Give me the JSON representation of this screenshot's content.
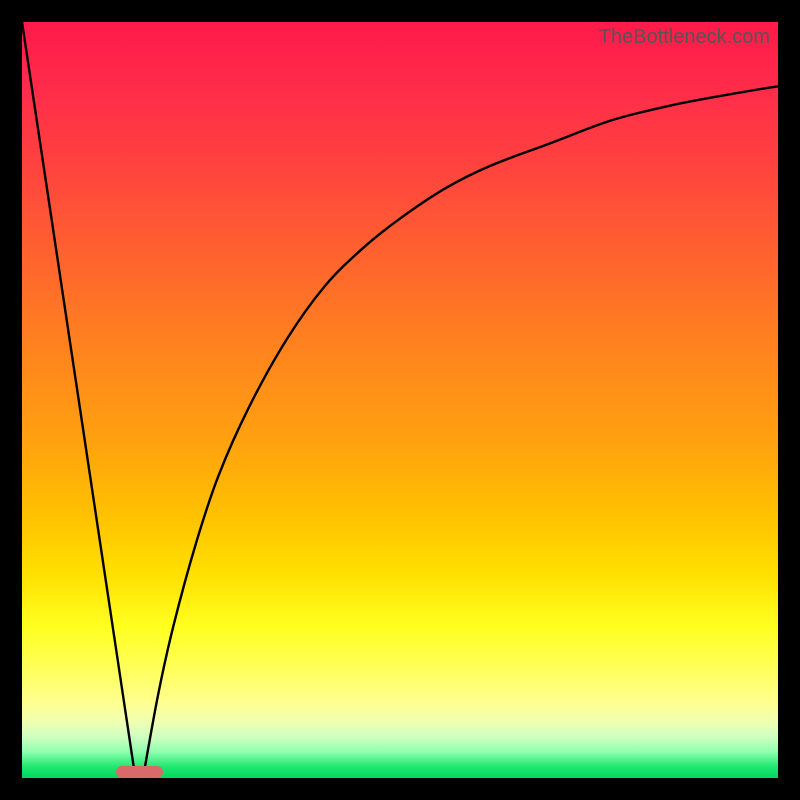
{
  "watermark": "TheBottleneck.com",
  "chart_data": {
    "type": "line",
    "title": "",
    "xlabel": "",
    "ylabel": "",
    "xlim": [
      0,
      100
    ],
    "ylim": [
      0,
      100
    ],
    "grid": false,
    "background_gradient": {
      "top": "#ff1a4a",
      "middle": "#ffe000",
      "bottom": "#00d860"
    },
    "marker": {
      "x_center": 15.5,
      "y": 0,
      "width": 6.2,
      "height": 1.6,
      "color": "#d86a6a"
    },
    "series": [
      {
        "name": "left-falling-line",
        "type": "line",
        "x": [
          0,
          15
        ],
        "y": [
          100,
          0
        ]
      },
      {
        "name": "right-rising-curve",
        "type": "line",
        "x": [
          16,
          18,
          20,
          23,
          26,
          30,
          35,
          40,
          45,
          50,
          56,
          62,
          70,
          78,
          86,
          94,
          100
        ],
        "y": [
          0,
          11,
          20,
          31,
          40,
          49,
          58,
          65,
          70,
          74,
          78,
          81,
          84,
          87,
          89,
          90.5,
          91.5
        ]
      }
    ]
  }
}
